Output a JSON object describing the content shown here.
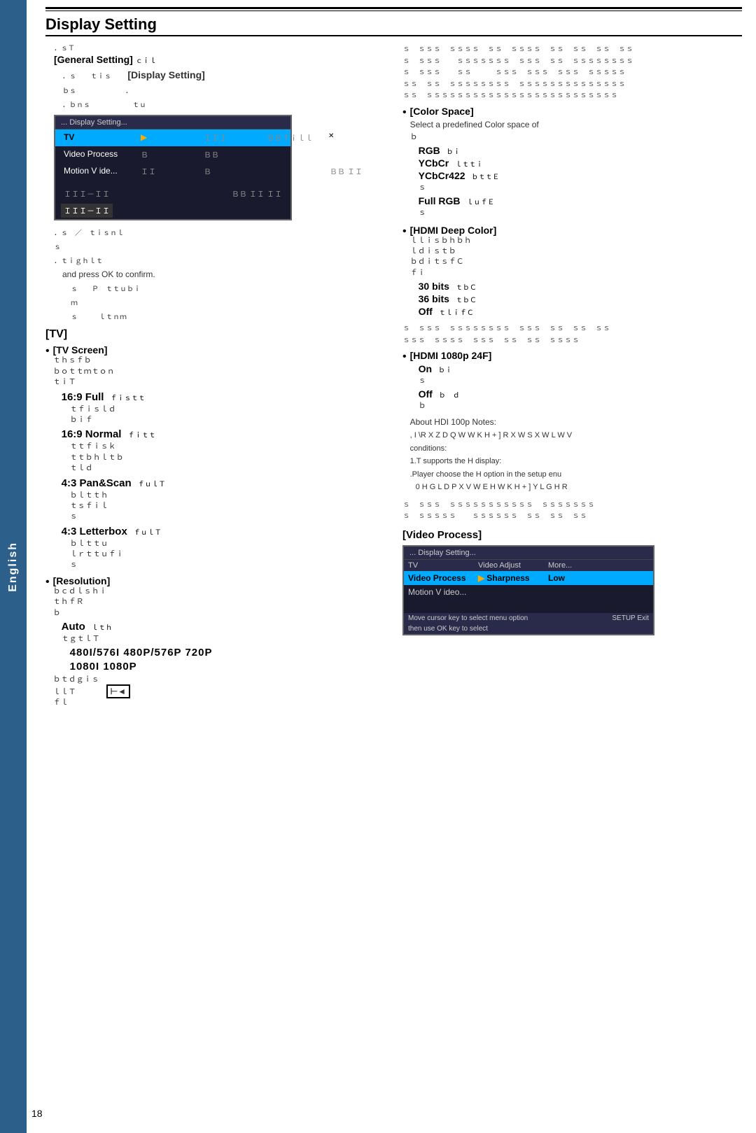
{
  "page": {
    "title": "Display Setting",
    "side_tab": "English",
    "page_number": "18"
  },
  "left_col": {
    "general_setting_label": "[General Setting]",
    "display_setting_ref": "[Display Setting]",
    "menu_screenshot": {
      "title": "... Display Setting...",
      "rows": [
        {
          "label": "TV",
          "arrow": "▶",
          "col2": "",
          "col3": ""
        },
        {
          "label": "Video Process",
          "col2": "",
          "col3": ""
        },
        {
          "label": "Motion V ide...",
          "col2": "",
          "col3": ""
        }
      ],
      "bottom_text": ""
    },
    "tv_section": {
      "heading": "[TV]",
      "tv_screen": {
        "label": "[TV Screen]",
        "modes": [
          {
            "name": "16:9 Full",
            "suffix": ""
          },
          {
            "name": "16:9 Normal",
            "suffix": ""
          },
          {
            "name": "4:3 Pan&Scan",
            "suffix": ""
          },
          {
            "name": "4:3 Letterbox",
            "suffix": ""
          }
        ]
      },
      "resolution": {
        "label": "[Resolution]",
        "auto": "Auto",
        "resolutions": "480I/576I   480P/576P   720P",
        "resolutions2": "1080I   1080P"
      }
    },
    "confirm_note": "and press OK to confirm."
  },
  "right_col": {
    "color_space": {
      "heading": "[Color Space]",
      "desc": "Select a predefined Color space of",
      "options": [
        "RGB",
        "YCbCr",
        "YCbCr422"
      ],
      "full_rgb": "Full RGB"
    },
    "hdmi_deep_color": {
      "heading": "[HDMI Deep Color]",
      "options": [
        "30 bits",
        "36 bits",
        "Off"
      ]
    },
    "hdmi_1080p": {
      "heading": "[HDMI 1080p 24F]",
      "on_label": "On",
      "off_label": "Off",
      "notes": [
        "About HDI 100p Notes:",
        ", I  \\R X  Z D Q W  W K H   + ]  R X W S X W  L W  V",
        "conditions:",
        "1.T supports the H display:",
        ".Player choose the H option in the setup enu",
        "0 H G L D  P X V W  E H  W K H   + ]  Y L G H R"
      ]
    },
    "video_process": {
      "heading": "[Video Process]",
      "menu": {
        "title": "... Display Setting...",
        "header_row": [
          "TV",
          "Video Adjust",
          "More..."
        ],
        "selected_row": [
          "Video Process",
          "▶ Sharpness",
          "Low"
        ],
        "row3": [
          "Motion V ideo..."
        ],
        "bottom": "Move cursor key to select menu option     SETUP  Exit",
        "bottom2": "then use  OK  key to select"
      }
    }
  }
}
